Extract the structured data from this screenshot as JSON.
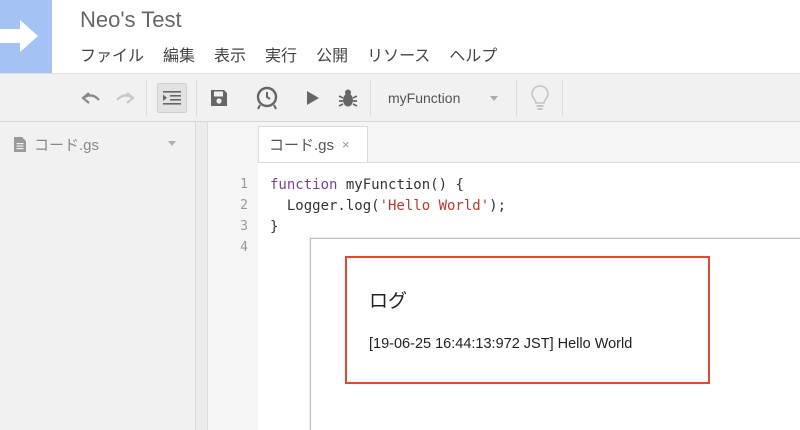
{
  "app": {
    "project_title": "Neo's Test",
    "brand_color": "#a4c2f4",
    "highlight_color": "#e8472b"
  },
  "menu": {
    "items": [
      "ファイル",
      "編集",
      "表示",
      "実行",
      "公開",
      "リソース",
      "ヘルプ"
    ]
  },
  "toolbar": {
    "icons": [
      "undo-icon",
      "redo-icon",
      "indent-icon",
      "save-icon",
      "triggers-clock-icon",
      "run-icon",
      "debug-bug-icon",
      "lightbulb-icon"
    ],
    "function_select": "myFunction"
  },
  "sidebar": {
    "file_name": "コード.gs"
  },
  "editor": {
    "tab_name": "コード.gs",
    "tab_close": "×",
    "line_numbers": [
      "1",
      "2",
      "3",
      "4"
    ],
    "code": {
      "l1_kw": "function",
      "l1_rest": " myFunction() {",
      "l2_pre": "  Logger.log(",
      "l2_str": "'Hello World'",
      "l2_post": ");",
      "l3": "}"
    }
  },
  "log_dialog": {
    "title": "ログ",
    "entry": "[19-06-25 16:44:13:972 JST] Hello World"
  }
}
